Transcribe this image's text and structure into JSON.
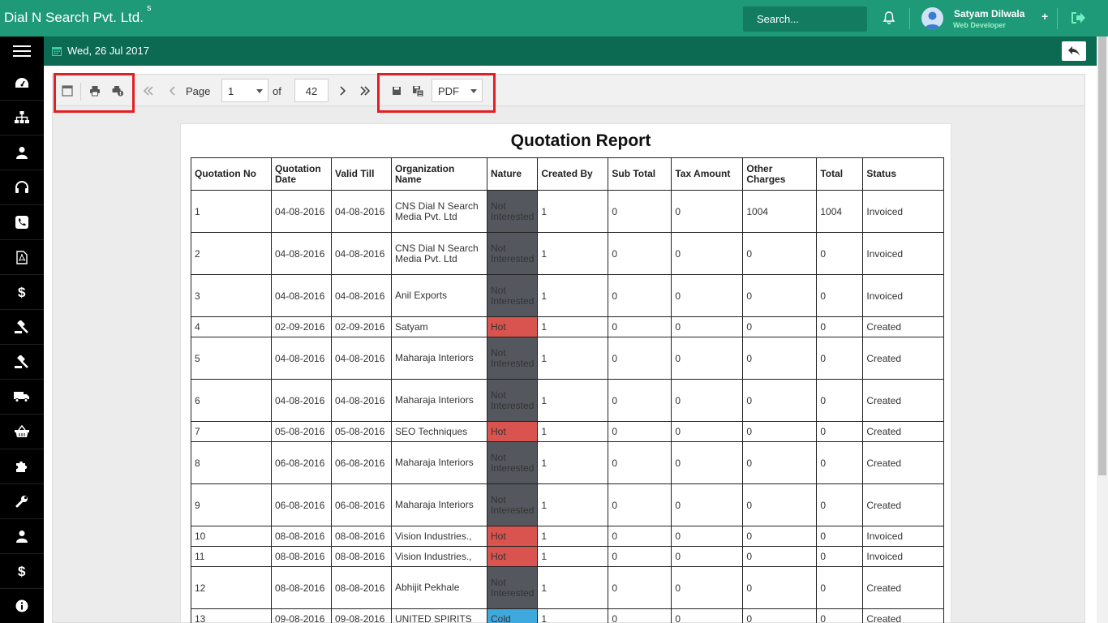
{
  "header": {
    "brand": "Dial N Search Pvt. Ltd.",
    "brand_sup": "s",
    "search_placeholder": "Search...",
    "user_name": "Satyam Dilwala",
    "user_role": "Web Developer",
    "plus": "+"
  },
  "subheader": {
    "date": "Wed, 26 Jul 2017"
  },
  "sidebar": {
    "items": [
      "dashboard-icon",
      "sitemap-icon",
      "user-icon",
      "headset-icon",
      "phone-icon",
      "pdf-icon",
      "dollar-icon",
      "gavel-icon",
      "gavel-icon",
      "truck-icon",
      "basket-icon",
      "puzzle-icon",
      "wrench-icon",
      "user-icon",
      "dollar-icon",
      "info-icon"
    ]
  },
  "toolbar": {
    "page_label": "Page",
    "page_value": "1",
    "of_label": "of",
    "total_pages": "42",
    "format": "PDF"
  },
  "report": {
    "title": "Quotation Report",
    "columns": [
      "Quotation No",
      "Quotation Date",
      "Valid Till",
      "Organization Name",
      "Nature",
      "Created By",
      "Sub Total",
      "Tax Amount",
      "Other Charges",
      "Total",
      "Status"
    ],
    "rows": [
      [
        "1",
        "04-08-2016",
        "04-08-2016",
        "CNS Dial N Search Media Pvt. Ltd",
        "Not Interested",
        "1",
        "0",
        "0",
        "1004",
        "1004",
        "Invoiced"
      ],
      [
        "2",
        "04-08-2016",
        "04-08-2016",
        "CNS Dial N Search Media Pvt. Ltd",
        "Not Interested",
        "1",
        "0",
        "0",
        "0",
        "0",
        "Invoiced"
      ],
      [
        "3",
        "04-08-2016",
        "04-08-2016",
        "Anil Exports",
        "Not Interested",
        "1",
        "0",
        "0",
        "0",
        "0",
        "Invoiced"
      ],
      [
        "4",
        "02-09-2016",
        "02-09-2016",
        "Satyam",
        "Hot",
        "1",
        "0",
        "0",
        "0",
        "0",
        "Created"
      ],
      [
        "5",
        "04-08-2016",
        "04-08-2016",
        "Maharaja Interiors",
        "Not Interested",
        "1",
        "0",
        "0",
        "0",
        "0",
        "Created"
      ],
      [
        "6",
        "04-08-2016",
        "04-08-2016",
        "Maharaja Interiors",
        "Not Interested",
        "1",
        "0",
        "0",
        "0",
        "0",
        "Created"
      ],
      [
        "7",
        "05-08-2016",
        "05-08-2016",
        "SEO Techniques",
        "Hot",
        "1",
        "0",
        "0",
        "0",
        "0",
        "Created"
      ],
      [
        "8",
        "06-08-2016",
        "06-08-2016",
        "Maharaja Interiors",
        "Not Interested",
        "1",
        "0",
        "0",
        "0",
        "0",
        "Created"
      ],
      [
        "9",
        "06-08-2016",
        "06-08-2016",
        "Maharaja Interiors",
        "Not Interested",
        "1",
        "0",
        "0",
        "0",
        "0",
        "Created"
      ],
      [
        "10",
        "08-08-2016",
        "08-08-2016",
        "Vision Industries.,",
        "Hot",
        "1",
        "0",
        "0",
        "0",
        "0",
        "Invoiced"
      ],
      [
        "11",
        "08-08-2016",
        "08-08-2016",
        "Vision Industries.,",
        "Hot",
        "1",
        "0",
        "0",
        "0",
        "0",
        "Invoiced"
      ],
      [
        "12",
        "08-08-2016",
        "08-08-2016",
        "Abhijit Pekhale",
        "Not Interested",
        "1",
        "0",
        "0",
        "0",
        "0",
        "Created"
      ],
      [
        "13",
        "09-08-2016",
        "09-08-2016",
        "UNITED SPIRITS",
        "Cold",
        "1",
        "0",
        "0",
        "0",
        "0",
        "Created"
      ]
    ]
  },
  "colors": {
    "header_green": "#1f9a78",
    "subheader_green": "#0d6a52",
    "nature_not_interested": "#54585e",
    "nature_hot": "#d9534f",
    "nature_cold": "#3fa9de",
    "highlight_red": "#e31e24"
  }
}
